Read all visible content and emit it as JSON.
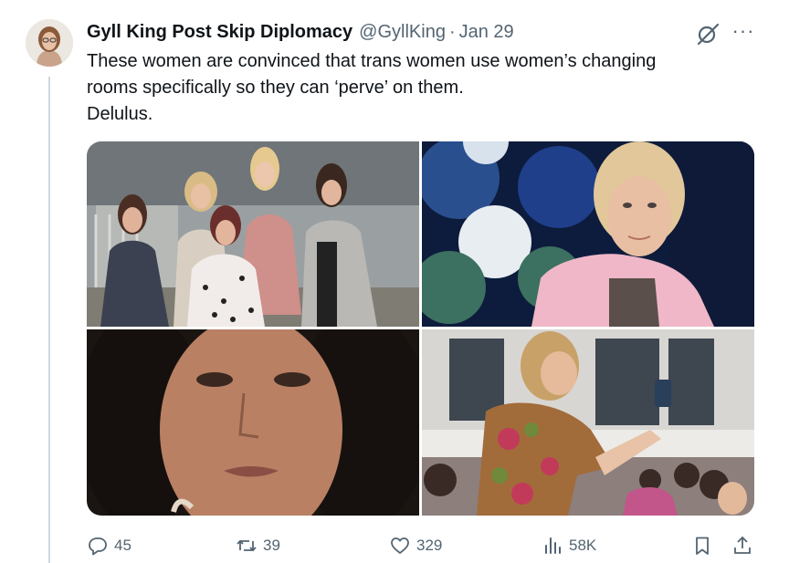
{
  "tweet": {
    "display_name": "Gyll King Post Skip Diplomacy",
    "handle": "@GyllKing",
    "separator": "·",
    "date": "Jan 29",
    "more": "···",
    "text_lines": [
      "These women are convinced that trans women use women’s changing",
      "rooms specifically so they can ‘perve’ on them.",
      "Delulus."
    ]
  },
  "media": [
    {
      "icon": "group-photo"
    },
    {
      "icon": "portrait-photo"
    },
    {
      "icon": "closeup-face-photo"
    },
    {
      "icon": "crowd-photo"
    }
  ],
  "actions": {
    "replies": "45",
    "reposts": "39",
    "likes": "329",
    "views": "58K"
  },
  "colors": {
    "text": "#0f1419",
    "secondary": "#536471",
    "thread_line": "#cfd9de"
  }
}
